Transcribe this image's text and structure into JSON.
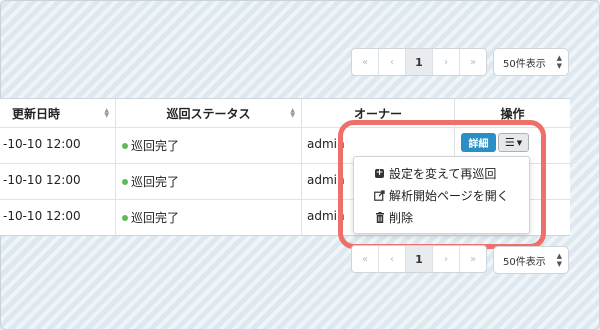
{
  "pagination": {
    "first": "«",
    "prev": "‹",
    "current": "1",
    "next": "›",
    "last": "»"
  },
  "per_page": {
    "selected": "50件表示"
  },
  "table": {
    "columns": [
      "更新日時",
      "巡回ステータス",
      "オーナー",
      "操作"
    ],
    "rows": [
      {
        "updated": "-10-10 12:00",
        "status": "巡回完了",
        "owner": "admin"
      },
      {
        "updated": "-10-10 12:00",
        "status": "巡回完了",
        "owner": "admin"
      },
      {
        "updated": "-10-10 12:00",
        "status": "巡回完了",
        "owner": "admin"
      }
    ]
  },
  "actions": {
    "detail": "詳細"
  },
  "dropdown": {
    "items": [
      {
        "label": "設定を変えて再巡回",
        "icon": "plus-square-icon"
      },
      {
        "label": "解析開始ページを開く",
        "icon": "external-link-icon"
      },
      {
        "label": "削除",
        "icon": "trash-icon"
      }
    ]
  },
  "colors": {
    "primary": "#2a8fc4",
    "status_ok": "#5cb85c",
    "highlight": "#ef6f6a"
  }
}
